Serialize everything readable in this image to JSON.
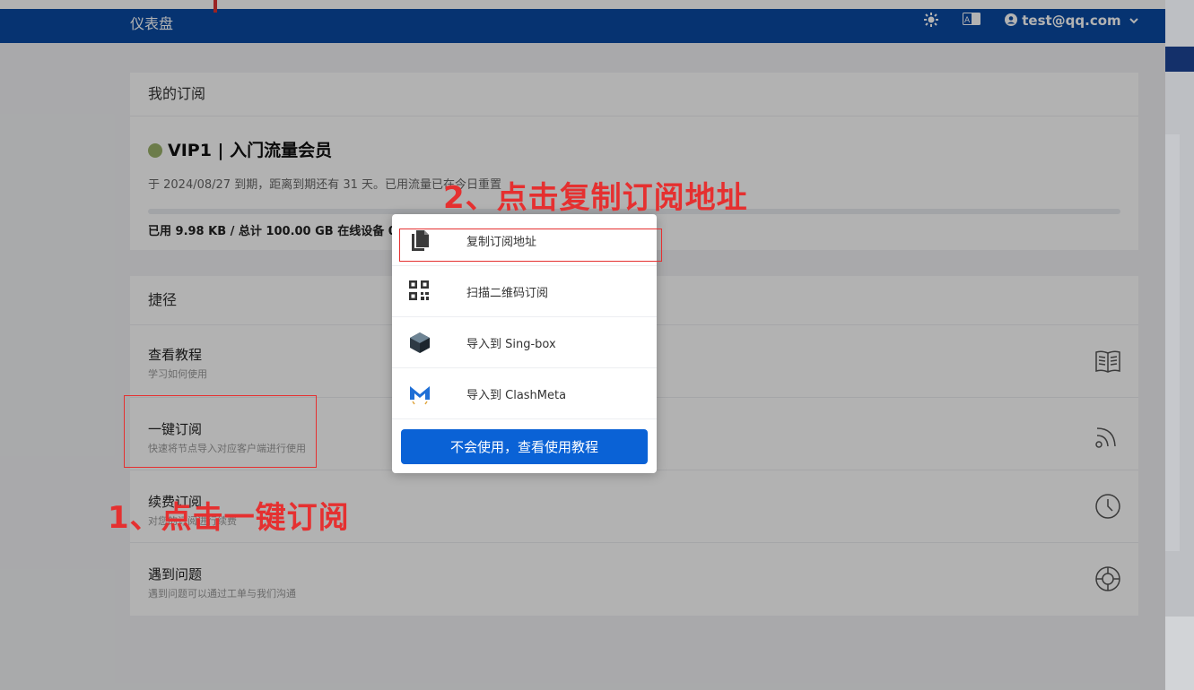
{
  "header": {
    "brand": "仪表盘",
    "user_email": "test@qq.com"
  },
  "subscription": {
    "card_title": "我的订阅",
    "plan_name": "VIP1 | 入门流量会员",
    "expire_text": "于 2024/08/27 到期，距离到期还有 31 天。已用流量已在今日重置",
    "usage_text": "已用 9.98 KB / 总计 100.00 GB 在线设备 0/3",
    "usage_fraction": 0.0
  },
  "shortcuts": {
    "card_title": "捷径",
    "items": [
      {
        "title": "查看教程",
        "desc": "学习如何使用",
        "icon": "book-icon"
      },
      {
        "title": "一键订阅",
        "desc": "快速将节点导入对应客户端进行使用",
        "icon": "rss-icon"
      },
      {
        "title": "续费订阅",
        "desc": "对您的订阅进行续费",
        "icon": "clock-icon"
      },
      {
        "title": "遇到问题",
        "desc": "遇到问题可以通过工单与我们沟通",
        "icon": "lifebuoy-icon"
      }
    ]
  },
  "modal": {
    "items": [
      {
        "label": "复制订阅地址",
        "icon": "copy-icon"
      },
      {
        "label": "扫描二维码订阅",
        "icon": "qrcode-icon"
      },
      {
        "label": "导入到 Sing-box",
        "icon": "sing-box-icon"
      },
      {
        "label": "导入到 ClashMeta",
        "icon": "clashmeta-icon"
      }
    ],
    "button_label": "不会使用，查看使用教程"
  },
  "annotations": {
    "step1": "1、点击一键订阅",
    "step2": "2、点击复制订阅地址"
  },
  "colors": {
    "brand_blue": "#0a4aa3",
    "button_blue": "#0a62d6",
    "annotation_red": "#e53030"
  }
}
